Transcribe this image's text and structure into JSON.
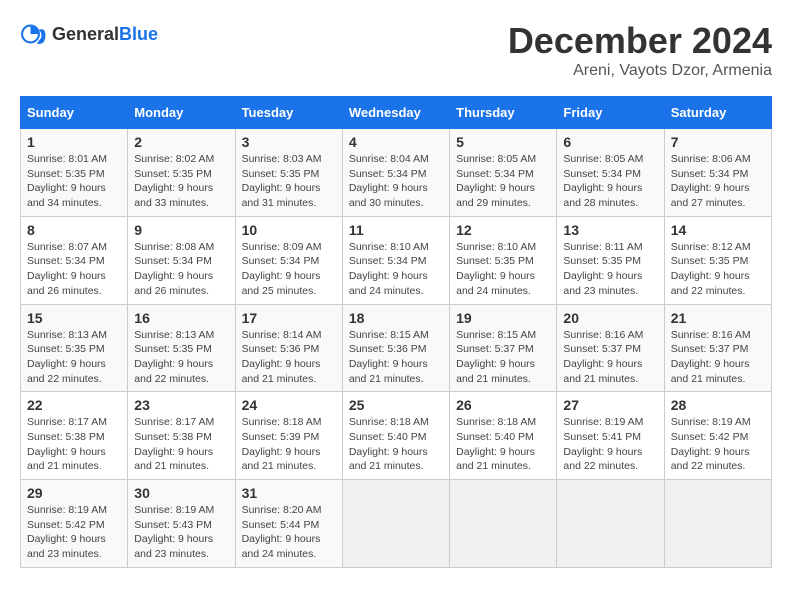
{
  "header": {
    "logo_general": "General",
    "logo_blue": "Blue",
    "month": "December 2024",
    "location": "Areni, Vayots Dzor, Armenia"
  },
  "weekdays": [
    "Sunday",
    "Monday",
    "Tuesday",
    "Wednesday",
    "Thursday",
    "Friday",
    "Saturday"
  ],
  "weeks": [
    [
      {
        "day": "1",
        "sunrise": "8:01 AM",
        "sunset": "5:35 PM",
        "daylight": "9 hours and 34 minutes."
      },
      {
        "day": "2",
        "sunrise": "8:02 AM",
        "sunset": "5:35 PM",
        "daylight": "9 hours and 33 minutes."
      },
      {
        "day": "3",
        "sunrise": "8:03 AM",
        "sunset": "5:35 PM",
        "daylight": "9 hours and 31 minutes."
      },
      {
        "day": "4",
        "sunrise": "8:04 AM",
        "sunset": "5:34 PM",
        "daylight": "9 hours and 30 minutes."
      },
      {
        "day": "5",
        "sunrise": "8:05 AM",
        "sunset": "5:34 PM",
        "daylight": "9 hours and 29 minutes."
      },
      {
        "day": "6",
        "sunrise": "8:05 AM",
        "sunset": "5:34 PM",
        "daylight": "9 hours and 28 minutes."
      },
      {
        "day": "7",
        "sunrise": "8:06 AM",
        "sunset": "5:34 PM",
        "daylight": "9 hours and 27 minutes."
      }
    ],
    [
      {
        "day": "8",
        "sunrise": "8:07 AM",
        "sunset": "5:34 PM",
        "daylight": "9 hours and 26 minutes."
      },
      {
        "day": "9",
        "sunrise": "8:08 AM",
        "sunset": "5:34 PM",
        "daylight": "9 hours and 26 minutes."
      },
      {
        "day": "10",
        "sunrise": "8:09 AM",
        "sunset": "5:34 PM",
        "daylight": "9 hours and 25 minutes."
      },
      {
        "day": "11",
        "sunrise": "8:10 AM",
        "sunset": "5:34 PM",
        "daylight": "9 hours and 24 minutes."
      },
      {
        "day": "12",
        "sunrise": "8:10 AM",
        "sunset": "5:35 PM",
        "daylight": "9 hours and 24 minutes."
      },
      {
        "day": "13",
        "sunrise": "8:11 AM",
        "sunset": "5:35 PM",
        "daylight": "9 hours and 23 minutes."
      },
      {
        "day": "14",
        "sunrise": "8:12 AM",
        "sunset": "5:35 PM",
        "daylight": "9 hours and 22 minutes."
      }
    ],
    [
      {
        "day": "15",
        "sunrise": "8:13 AM",
        "sunset": "5:35 PM",
        "daylight": "9 hours and 22 minutes."
      },
      {
        "day": "16",
        "sunrise": "8:13 AM",
        "sunset": "5:35 PM",
        "daylight": "9 hours and 22 minutes."
      },
      {
        "day": "17",
        "sunrise": "8:14 AM",
        "sunset": "5:36 PM",
        "daylight": "9 hours and 21 minutes."
      },
      {
        "day": "18",
        "sunrise": "8:15 AM",
        "sunset": "5:36 PM",
        "daylight": "9 hours and 21 minutes."
      },
      {
        "day": "19",
        "sunrise": "8:15 AM",
        "sunset": "5:37 PM",
        "daylight": "9 hours and 21 minutes."
      },
      {
        "day": "20",
        "sunrise": "8:16 AM",
        "sunset": "5:37 PM",
        "daylight": "9 hours and 21 minutes."
      },
      {
        "day": "21",
        "sunrise": "8:16 AM",
        "sunset": "5:37 PM",
        "daylight": "9 hours and 21 minutes."
      }
    ],
    [
      {
        "day": "22",
        "sunrise": "8:17 AM",
        "sunset": "5:38 PM",
        "daylight": "9 hours and 21 minutes."
      },
      {
        "day": "23",
        "sunrise": "8:17 AM",
        "sunset": "5:38 PM",
        "daylight": "9 hours and 21 minutes."
      },
      {
        "day": "24",
        "sunrise": "8:18 AM",
        "sunset": "5:39 PM",
        "daylight": "9 hours and 21 minutes."
      },
      {
        "day": "25",
        "sunrise": "8:18 AM",
        "sunset": "5:40 PM",
        "daylight": "9 hours and 21 minutes."
      },
      {
        "day": "26",
        "sunrise": "8:18 AM",
        "sunset": "5:40 PM",
        "daylight": "9 hours and 21 minutes."
      },
      {
        "day": "27",
        "sunrise": "8:19 AM",
        "sunset": "5:41 PM",
        "daylight": "9 hours and 22 minutes."
      },
      {
        "day": "28",
        "sunrise": "8:19 AM",
        "sunset": "5:42 PM",
        "daylight": "9 hours and 22 minutes."
      }
    ],
    [
      {
        "day": "29",
        "sunrise": "8:19 AM",
        "sunset": "5:42 PM",
        "daylight": "9 hours and 23 minutes."
      },
      {
        "day": "30",
        "sunrise": "8:19 AM",
        "sunset": "5:43 PM",
        "daylight": "9 hours and 23 minutes."
      },
      {
        "day": "31",
        "sunrise": "8:20 AM",
        "sunset": "5:44 PM",
        "daylight": "9 hours and 24 minutes."
      },
      null,
      null,
      null,
      null
    ]
  ]
}
